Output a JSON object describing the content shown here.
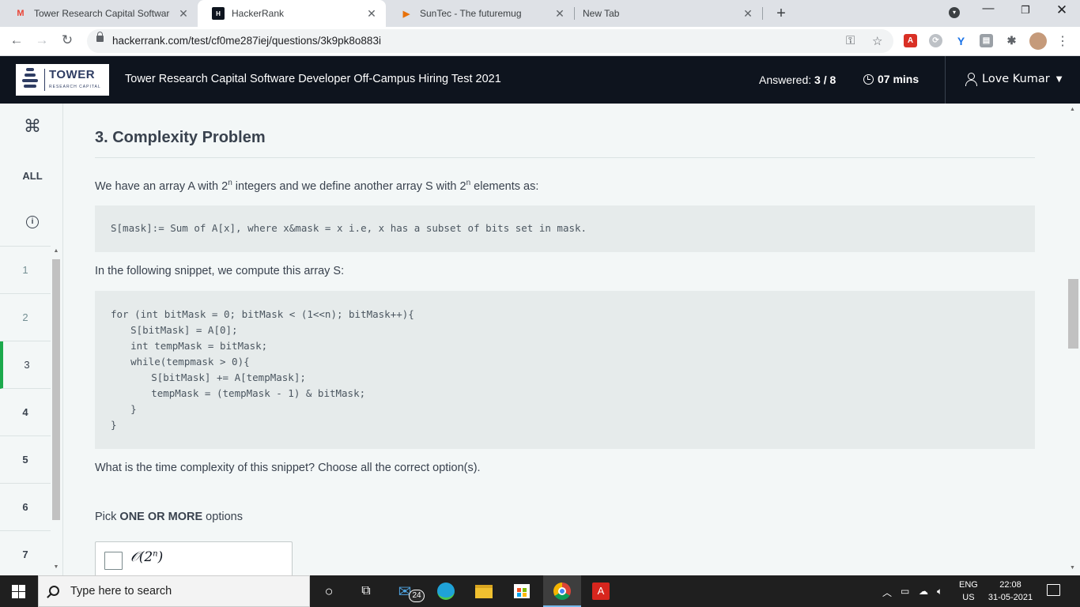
{
  "browser": {
    "tabs": [
      {
        "title": "Tower Research Capital Software",
        "favicon": "gmail-icon"
      },
      {
        "title": "HackerRank",
        "favicon": "hackerrank-icon",
        "active": true
      },
      {
        "title": "SunTec - The futuremug",
        "favicon": "suntec-icon"
      },
      {
        "title": "New Tab",
        "favicon": ""
      }
    ],
    "new_tab": "+",
    "url": "hackerrank.com/test/cf0me287iej/questions/3k9pk8o883i"
  },
  "header": {
    "logo_text": "TOWER",
    "logo_sub": "RESEARCH CAPITAL",
    "test_title": "Tower Research Capital Software Developer Off-Campus Hiring Test 2021",
    "answered_label": "Answered:",
    "answered_value": "3 / 8",
    "timer": "07 mins",
    "user_name": "Love Kumar"
  },
  "sidebar": {
    "cmd_glyph": "⌘",
    "all_label": "ALL",
    "info_glyph": "i",
    "questions": [
      "1",
      "2",
      "3",
      "4",
      "5",
      "6",
      "7"
    ]
  },
  "question": {
    "title": "3. Complexity Problem",
    "intro_a": "We have an array A with 2",
    "intro_sup1": "n",
    "intro_b": " integers and we define another array S with 2",
    "intro_sup2": "n",
    "intro_c": " elements as:",
    "definition": "S[mask]:= Sum of A[x], where x&mask = x i.e, x has a subset of bits set in mask.",
    "snippet_intro": "In the following snippet, we compute this array S:",
    "code_lines": [
      "for (int bitMask = 0; bitMask < (1<<n); bitMask++){",
      "    S[bitMask] = A[0];",
      "    int tempMask = bitMask;",
      "    while(tempmask > 0){",
      "        S[bitMask] += A[tempMask];",
      "        tempMask = (tempMask - 1) & bitMask;",
      "    }",
      "}"
    ],
    "prompt": "What is the time complexity of this snippet? Choose all the correct option(s).",
    "pick_prefix": "Pick ",
    "pick_bold": "ONE OR MORE",
    "pick_suffix": " options",
    "options": [
      {
        "label_base": "𝒪(2",
        "label_sup": "n",
        "label_end": ")"
      }
    ]
  },
  "taskbar": {
    "search_placeholder": "Type here to search",
    "mail_badge": "24",
    "lang_line1": "ENG",
    "lang_line2": "US",
    "time": "22:08",
    "date": "31-05-2021"
  }
}
